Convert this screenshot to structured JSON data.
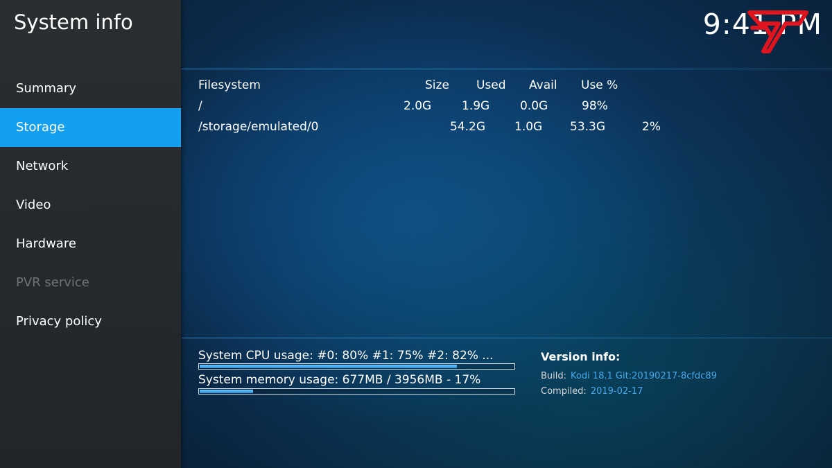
{
  "app": {
    "title": "System info",
    "clock": "9:41 PM"
  },
  "sidebar": {
    "items": [
      {
        "label": "Summary",
        "state": "normal"
      },
      {
        "label": "Storage",
        "state": "active"
      },
      {
        "label": "Network",
        "state": "normal"
      },
      {
        "label": "Video",
        "state": "normal"
      },
      {
        "label": "Hardware",
        "state": "normal"
      },
      {
        "label": "PVR service",
        "state": "disabled"
      },
      {
        "label": "Privacy policy",
        "state": "normal"
      }
    ]
  },
  "storage": {
    "headers": {
      "filesystem": "Filesystem",
      "size": "Size",
      "used": "Used",
      "avail": "Avail",
      "use_pct": "Use %"
    },
    "rows": [
      {
        "filesystem": "/",
        "size": "2.0G",
        "used": "1.9G",
        "avail": "0.0G",
        "use_pct": "98%"
      },
      {
        "filesystem": "/storage/emulated/0",
        "size": "54.2G",
        "used": "1.0G",
        "avail": "53.3G",
        "use_pct": "2%"
      }
    ]
  },
  "usage": {
    "cpu": {
      "label": "System CPU usage: #0:  80% #1:  75% #2:  82% ...",
      "fraction": 0.82
    },
    "memory": {
      "label": "System memory usage: 677MB / 3956MB - 17%",
      "fraction": 0.17
    }
  },
  "version": {
    "title": "Version info:",
    "build_label": "Build:",
    "build_value": "Kodi 18.1 Git:20190217-8cfdc89",
    "compiled_label": "Compiled:",
    "compiled_value": "2019-02-17"
  },
  "colors": {
    "accent": "#14a0f0",
    "link": "#4aa8e8",
    "watermark": "#e0141e"
  },
  "icons": {
    "watermark": "rd-logo-watermark"
  }
}
